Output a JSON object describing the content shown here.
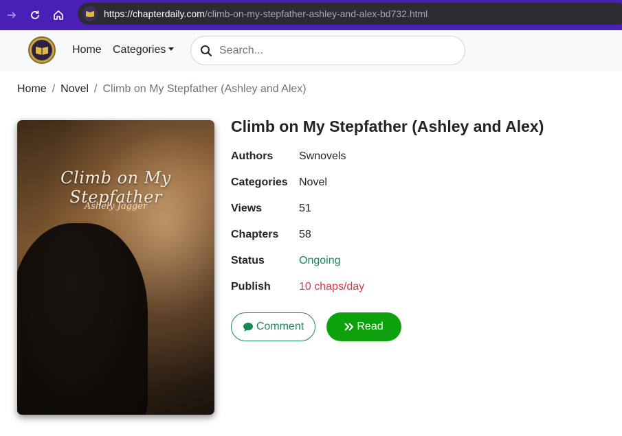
{
  "browser": {
    "url_host": "https://chapterdaily.com",
    "url_path": "/climb-on-my-stepfather-ashley-and-alex-bd732.html",
    "icons": [
      "forward-icon",
      "reload-icon",
      "home-icon"
    ]
  },
  "navbar": {
    "home_label": "Home",
    "categories_label": "Categories",
    "search_placeholder": "Search..."
  },
  "breadcrumb": {
    "items": [
      "Home",
      "Novel"
    ],
    "separator": "/",
    "current": "Climb on My Stepfather (Ashley and Alex)"
  },
  "cover": {
    "title": "Climb on My Stepfather",
    "author": "Ashely Jagger"
  },
  "book": {
    "title": "Climb on My Stepfather (Ashley and Alex)",
    "details": [
      {
        "label": "Authors",
        "value": "Swnovels"
      },
      {
        "label": "Categories",
        "value": "Novel"
      },
      {
        "label": "Views",
        "value": "51"
      },
      {
        "label": "Chapters",
        "value": "58"
      },
      {
        "label": "Status",
        "value": "Ongoing"
      },
      {
        "label": "Publish",
        "value": "10 chaps/day"
      }
    ]
  },
  "actions": {
    "comment_label": "Comment",
    "read_label": "Read"
  },
  "colors": {
    "chrome": "#4a1fb8",
    "status_green": "#198754",
    "publish_red": "#dc3545",
    "read_button": "#0ea10e"
  }
}
